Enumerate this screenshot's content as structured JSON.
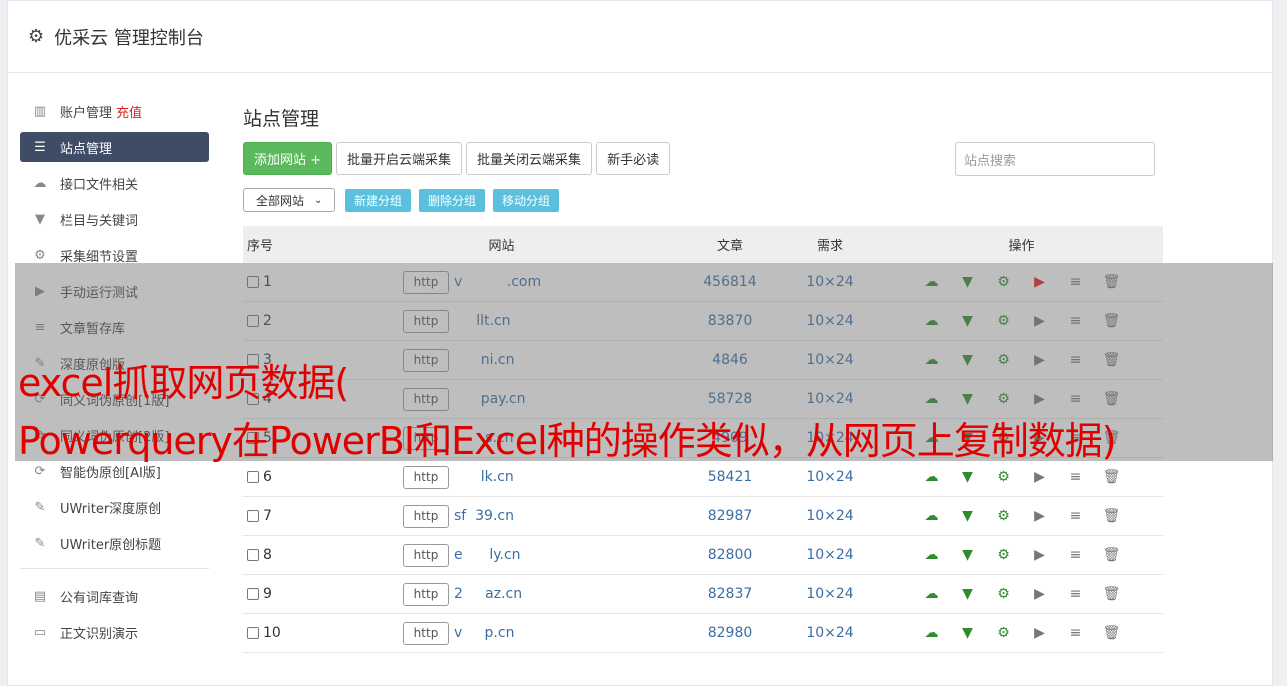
{
  "header": {
    "title": "优采云 管理控制台"
  },
  "sidebar": {
    "items": [
      {
        "label": "账户管理",
        "extra": "充值",
        "icon": "bar-chart-icon"
      },
      {
        "label": "站点管理",
        "icon": "server-icon"
      },
      {
        "label": "接口文件相关",
        "icon": "cloud-upload-icon"
      },
      {
        "label": "栏目与关键词",
        "icon": "filter-icon"
      },
      {
        "label": "采集细节设置",
        "icon": "cogs-icon"
      },
      {
        "label": "手动运行测试",
        "icon": "play-icon"
      },
      {
        "label": "文章暂存库",
        "icon": "database-icon"
      },
      {
        "label": "深度原创版",
        "icon": "edit-icon"
      },
      {
        "label": "同义词伪原创[1版]",
        "icon": "refresh-icon"
      },
      {
        "label": "同义词伪原创[2版]",
        "icon": "refresh-icon"
      },
      {
        "label": "智能伪原创[AI版]",
        "icon": "refresh-icon"
      },
      {
        "label": "UWriter深度原创",
        "icon": "edit-icon"
      },
      {
        "label": "UWriter原创标题",
        "icon": "edit-icon"
      }
    ],
    "items2": [
      {
        "label": "公有词库查询",
        "icon": "book-icon"
      },
      {
        "label": "正文识别演示",
        "icon": "monitor-icon"
      }
    ]
  },
  "main": {
    "title": "站点管理",
    "toolbar": {
      "add": "添加网站 +",
      "batch_open": "批量开启云端采集",
      "batch_close": "批量关闭云端采集",
      "guide": "新手必读"
    },
    "search_placeholder": "站点搜索",
    "group_select": "全部网站",
    "group_buttons": {
      "new": "新建分组",
      "delete": "删除分组",
      "move": "移动分组"
    },
    "table": {
      "headers": {
        "num": "序号",
        "site": "网站",
        "articles": "文章",
        "demand": "需求",
        "ops": "操作"
      },
      "http_label": "http",
      "rows": [
        {
          "num": "1",
          "site": "v          .com",
          "articles": "456814",
          "demand": "10×24"
        },
        {
          "num": "2",
          "site": "     llt.cn",
          "articles": "83870",
          "demand": "10×24"
        },
        {
          "num": "3",
          "site": "      ni.cn",
          "articles": "4846",
          "demand": "10×24"
        },
        {
          "num": "4",
          "site": "      pay.cn",
          "articles": "58728",
          "demand": "10×24"
        },
        {
          "num": "5",
          "site": "       s.cn",
          "articles": "4909",
          "demand": "10×24"
        },
        {
          "num": "6",
          "site": "      lk.cn",
          "articles": "58421",
          "demand": "10×24"
        },
        {
          "num": "7",
          "site": "sf  39.cn",
          "articles": "82987",
          "demand": "10×24"
        },
        {
          "num": "8",
          "site": "e      ly.cn",
          "articles": "82800",
          "demand": "10×24"
        },
        {
          "num": "9",
          "site": "2     az.cn",
          "articles": "82837",
          "demand": "10×24"
        },
        {
          "num": "10",
          "site": "v     p.cn",
          "articles": "82980",
          "demand": "10×24"
        }
      ]
    }
  },
  "overlay": {
    "line1": "excel抓取网页数据(",
    "line2": "Powerquery在PowerBI和Excel种的操作类似，从网页上复制数据)"
  },
  "colors": {
    "accent_green": "#5cb85c",
    "accent_blue": "#5bc0de",
    "active_nav": "#3e4c66",
    "overlay_text": "#e00000"
  }
}
